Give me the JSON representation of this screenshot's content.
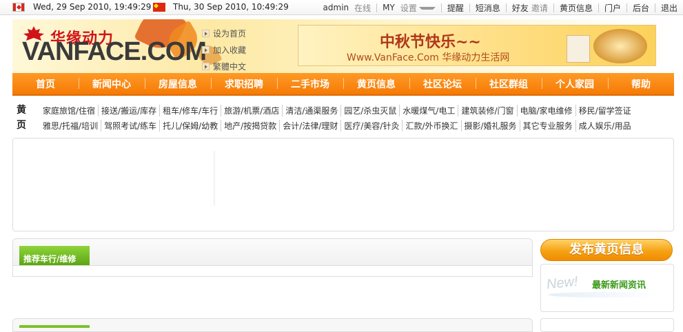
{
  "topbar": {
    "canada_time": "Wed, 29 Sep 2010, 19:49:29",
    "china_time": "Thu, 30 Sep 2010, 10:49:29",
    "user": "admin",
    "status": "在线",
    "my": "MY",
    "settings": "设置",
    "links": [
      "提醒",
      "短消息",
      "好友",
      "邀请",
      "黄页信息",
      "门户",
      "后台",
      "退出"
    ]
  },
  "header": {
    "logo_cn": "华缘动力",
    "logo_en": "VANFACE.COM",
    "quick_links": [
      "设为首页",
      "加入收藏",
      "繁體中文"
    ],
    "banner_title": "中秋节快乐~~",
    "banner_sub": "Www.VanFace.Com 华缘动力生活网"
  },
  "nav": [
    "首页",
    "新闻中心",
    "房屋信息",
    "求职招聘",
    "二手市场",
    "黄页信息",
    "社区论坛",
    "社区群组",
    "个人家园",
    "帮助"
  ],
  "yellow_pages": {
    "label": "黄页",
    "row1": [
      "家庭旅馆/住宿",
      "接送/搬运/库存",
      "租车/修车/车行",
      "旅游/机票/酒店",
      "清洁/通渠服务",
      "园艺/杀虫灭鼠",
      "水暖煤气/电工",
      "建筑装修/门窗",
      "电脑/家电维修",
      "移民/留学签证"
    ],
    "row2": [
      "雅思/托福/培训",
      "驾照考试/练车",
      "托儿/保姆/幼教",
      "地产/按揭贷款",
      "会计/法律/理财",
      "医疗/美容/针灸",
      "汇款/外币换汇",
      "摄影/婚礼服务",
      "其它专业服务",
      "成人娱乐/用品"
    ]
  },
  "recommend": {
    "tab": "推荐车行/维修"
  },
  "sidebar": {
    "publish_button": "发布黄页信息",
    "new_badge": "New!",
    "news_title": "最新新闻资讯"
  },
  "colors": {
    "nav_orange": "#f57b05",
    "tab_green": "#5aa412",
    "logo_red": "#d0141a"
  }
}
